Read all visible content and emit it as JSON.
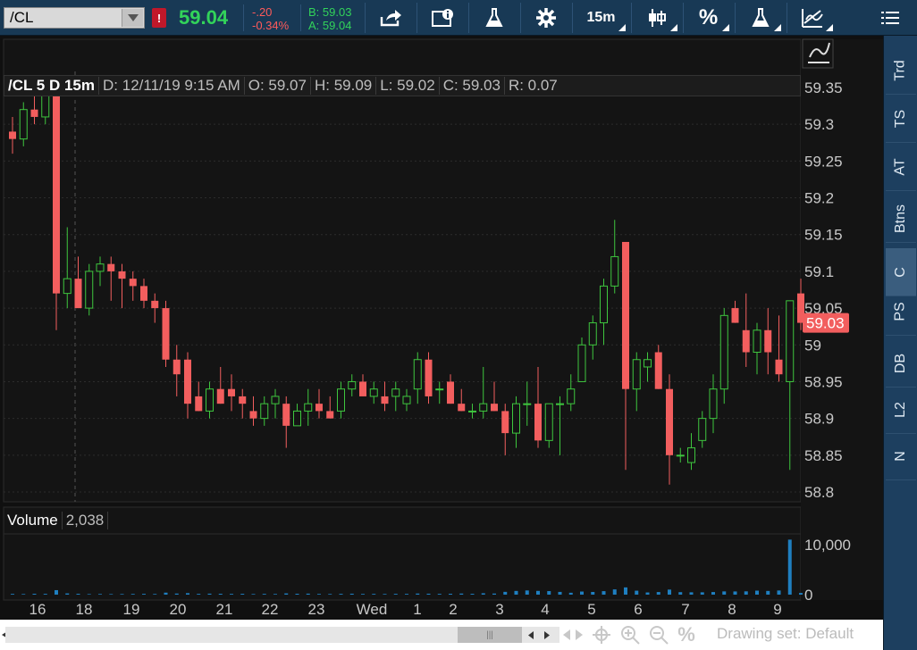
{
  "toolbar": {
    "symbol": "/CL",
    "alert": "!",
    "last_price": "59.04",
    "change": "-.20",
    "change_pct": "-0.34%",
    "bid": "B: 59.03",
    "ask": "A: 59.04",
    "timeframe": "15m",
    "percent": "%"
  },
  "header": {
    "title": "/CL 5 D 15m",
    "date": "D: 12/11/19 9:15 AM",
    "open": "O: 59.07",
    "high": "H: 59.09",
    "low": "L: 59.02",
    "close": "C: 59.03",
    "range": "R: 0.07"
  },
  "volume_panel": {
    "label": "Volume",
    "value": "2,038"
  },
  "sidebar": {
    "tabs": [
      "Trd",
      "TS",
      "AT",
      "Btns",
      "C",
      "PS",
      "DB",
      "L2",
      "N"
    ],
    "active": "C"
  },
  "bottom": {
    "drawing_set": "Drawing set: Default",
    "percent": "%"
  },
  "colors": {
    "up": "#3ec63e",
    "down": "#f25e5e",
    "volume": "#1f7fc0",
    "last_tag": "#f25e5e"
  },
  "chart_data": {
    "type": "candlestick",
    "price_axis": {
      "ticks": [
        "59.35",
        "59.3",
        "59.25",
        "59.2",
        "59.15",
        "59.1",
        "59.05",
        "59",
        "58.95",
        "58.9",
        "58.85",
        "58.8"
      ],
      "min": 58.8,
      "max": 59.35
    },
    "last_price_tag": "59.03",
    "volume_axis": {
      "ticks": [
        "10,000",
        "0"
      ],
      "max": 10000
    },
    "x_ticks": [
      "16",
      "18",
      "19",
      "20",
      "21",
      "22",
      "23",
      "Wed",
      "1",
      "2",
      "3",
      "4",
      "5",
      "6",
      "7",
      "8",
      "9"
    ],
    "candles": [
      [
        59.29,
        59.31,
        59.26,
        59.28
      ],
      [
        59.28,
        59.33,
        59.27,
        59.32
      ],
      [
        59.32,
        59.34,
        59.3,
        59.31
      ],
      [
        59.31,
        59.36,
        59.3,
        59.34
      ],
      [
        59.34,
        59.35,
        59.02,
        59.07
      ],
      [
        59.07,
        59.16,
        59.05,
        59.09
      ],
      [
        59.09,
        59.12,
        59.05,
        59.05
      ],
      [
        59.05,
        59.11,
        59.04,
        59.1
      ],
      [
        59.1,
        59.12,
        59.08,
        59.11
      ],
      [
        59.11,
        59.12,
        59.06,
        59.1
      ],
      [
        59.1,
        59.11,
        59.05,
        59.09
      ],
      [
        59.09,
        59.1,
        59.06,
        59.08
      ],
      [
        59.08,
        59.09,
        59.05,
        59.06
      ],
      [
        59.06,
        59.07,
        59.03,
        59.05
      ],
      [
        59.05,
        59.06,
        58.97,
        58.98
      ],
      [
        58.98,
        59.0,
        58.93,
        58.96
      ],
      [
        58.98,
        58.99,
        58.9,
        58.92
      ],
      [
        58.93,
        58.95,
        58.91,
        58.91
      ],
      [
        58.91,
        58.95,
        58.9,
        58.94
      ],
      [
        58.94,
        58.97,
        58.92,
        58.92
      ],
      [
        58.94,
        58.96,
        58.91,
        58.93
      ],
      [
        58.93,
        58.94,
        58.9,
        58.92
      ],
      [
        58.91,
        58.93,
        58.89,
        58.9
      ],
      [
        58.9,
        58.93,
        58.89,
        58.92
      ],
      [
        58.92,
        58.94,
        58.9,
        58.93
      ],
      [
        58.92,
        58.93,
        58.86,
        58.89
      ],
      [
        58.89,
        58.92,
        58.89,
        58.91
      ],
      [
        58.91,
        58.94,
        58.89,
        58.92
      ],
      [
        58.92,
        58.94,
        58.9,
        58.91
      ],
      [
        58.91,
        58.93,
        58.9,
        58.9
      ],
      [
        58.91,
        58.95,
        58.9,
        58.94
      ],
      [
        58.94,
        58.96,
        58.93,
        58.95
      ],
      [
        58.95,
        58.96,
        58.93,
        58.93
      ],
      [
        58.93,
        58.95,
        58.92,
        58.94
      ],
      [
        58.93,
        58.95,
        58.91,
        58.92
      ],
      [
        58.93,
        58.95,
        58.91,
        58.94
      ],
      [
        58.92,
        58.94,
        58.91,
        58.93
      ],
      [
        58.94,
        58.99,
        58.92,
        58.98
      ],
      [
        58.98,
        58.99,
        58.92,
        58.93
      ],
      [
        58.94,
        58.95,
        58.92,
        58.94
      ],
      [
        58.95,
        58.96,
        58.92,
        58.92
      ],
      [
        58.92,
        58.94,
        58.91,
        58.91
      ],
      [
        58.91,
        58.92,
        58.9,
        58.91
      ],
      [
        58.91,
        58.97,
        58.9,
        58.92
      ],
      [
        58.92,
        58.95,
        58.91,
        58.91
      ],
      [
        58.91,
        58.92,
        58.85,
        58.88
      ],
      [
        58.88,
        58.93,
        58.86,
        58.92
      ],
      [
        58.92,
        58.95,
        58.89,
        58.92
      ],
      [
        58.92,
        58.97,
        58.86,
        58.87
      ],
      [
        58.87,
        58.92,
        58.86,
        58.92
      ],
      [
        58.92,
        58.93,
        58.85,
        58.92
      ],
      [
        58.92,
        58.96,
        58.91,
        58.94
      ],
      [
        58.95,
        59.01,
        58.95,
        59.0
      ],
      [
        59.0,
        59.04,
        58.98,
        59.03
      ],
      [
        59.03,
        59.09,
        59.0,
        59.08
      ],
      [
        59.08,
        59.17,
        59.07,
        59.12
      ],
      [
        59.14,
        59.14,
        58.83,
        58.94
      ],
      [
        58.94,
        58.99,
        58.91,
        58.98
      ],
      [
        58.97,
        58.99,
        58.95,
        58.98
      ],
      [
        58.99,
        59.0,
        58.94,
        58.94
      ],
      [
        58.94,
        58.96,
        58.81,
        58.85
      ],
      [
        58.85,
        58.86,
        58.84,
        58.85
      ],
      [
        58.84,
        58.88,
        58.83,
        58.86
      ],
      [
        58.87,
        58.91,
        58.86,
        58.9
      ],
      [
        58.9,
        58.96,
        58.88,
        58.94
      ],
      [
        58.94,
        59.05,
        58.92,
        59.04
      ],
      [
        59.05,
        59.06,
        59.03,
        59.03
      ],
      [
        59.02,
        59.07,
        58.97,
        58.99
      ],
      [
        58.99,
        59.03,
        58.96,
        59.02
      ],
      [
        59.02,
        59.05,
        58.96,
        58.99
      ],
      [
        58.98,
        59.04,
        58.95,
        58.96
      ],
      [
        58.95,
        59.06,
        58.83,
        59.06
      ],
      [
        59.07,
        59.09,
        59.02,
        59.03
      ]
    ],
    "volumes": [
      150,
      120,
      180,
      160,
      900,
      250,
      170,
      110,
      130,
      110,
      120,
      140,
      160,
      130,
      400,
      220,
      300,
      160,
      200,
      180,
      150,
      170,
      120,
      150,
      130,
      250,
      180,
      200,
      140,
      130,
      160,
      190,
      140,
      150,
      130,
      160,
      150,
      220,
      190,
      160,
      180,
      220,
      170,
      280,
      220,
      560,
      740,
      840,
      750,
      710,
      550,
      380,
      620,
      540,
      700,
      1050,
      1450,
      790,
      440,
      520,
      1010,
      500,
      470,
      470,
      520,
      650,
      640,
      660,
      800,
      740,
      830,
      12000,
      340
    ]
  }
}
